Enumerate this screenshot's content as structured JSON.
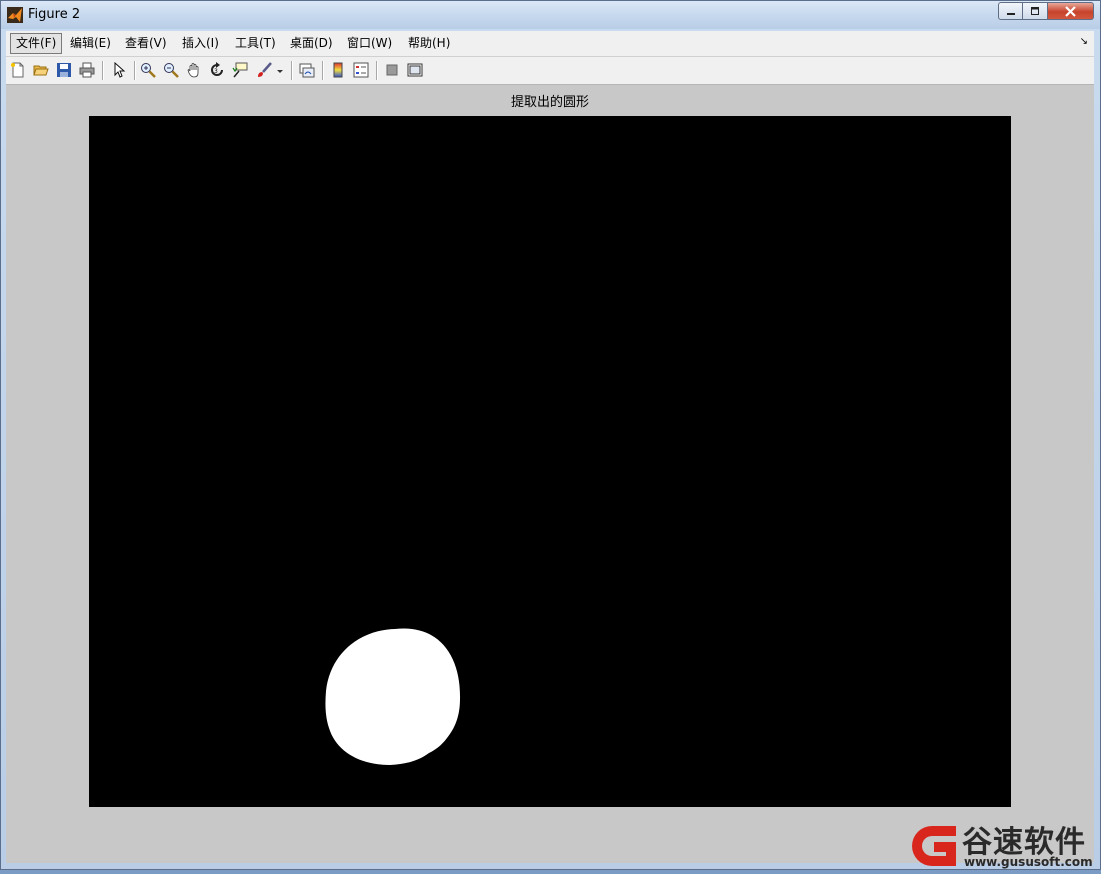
{
  "window": {
    "title": "Figure 2"
  },
  "menubar": {
    "items": [
      {
        "label": "文件(F)"
      },
      {
        "label": "编辑(E)"
      },
      {
        "label": "查看(V)"
      },
      {
        "label": "插入(I)"
      },
      {
        "label": "工具(T)"
      },
      {
        "label": "桌面(D)"
      },
      {
        "label": "窗口(W)"
      },
      {
        "label": "帮助(H)"
      }
    ]
  },
  "figure": {
    "title": "提取出的圆形"
  },
  "colors": {
    "background": "#c8c8c8",
    "axes": "#000000",
    "shape": "#ffffff",
    "watermark_red": "#d9261c"
  },
  "watermark": {
    "name": "谷速软件",
    "url": "www.gususoft.com"
  }
}
